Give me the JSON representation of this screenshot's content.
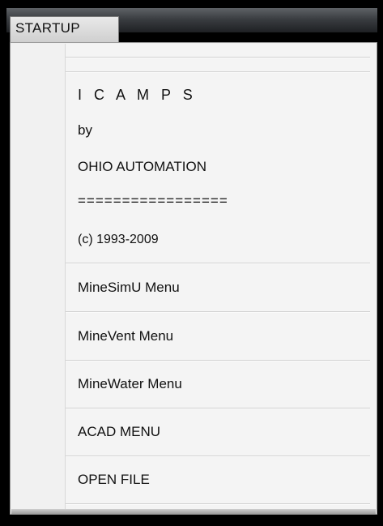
{
  "window": {
    "menu_tab": "STARTUP"
  },
  "menu": {
    "header": [
      "I C A M P S",
      "by",
      "OHIO AUTOMATION",
      "=================",
      "(c) 1993-2009"
    ],
    "items": [
      "MineSimU Menu",
      "MineVent Menu",
      "MineWater Menu",
      "ACAD MENU",
      "OPEN FILE"
    ]
  }
}
